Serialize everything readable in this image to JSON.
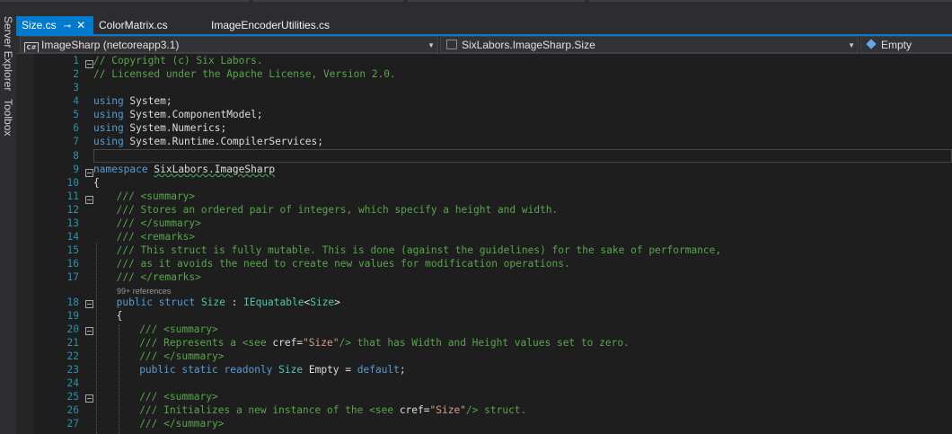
{
  "left_tool_tabs": [
    "Server Explorer",
    "Toolbox"
  ],
  "tabs": [
    {
      "label": "Size.cs",
      "active": true
    },
    {
      "label": "ColorMatrix.cs",
      "active": false
    },
    {
      "label": "ImageEncoderUtilities.cs",
      "active": false
    }
  ],
  "navbar": {
    "project": "ImageSharp (netcoreapp3.1)",
    "type": "SixLabors.ImageSharp.Size",
    "member": "Empty"
  },
  "code_lens": "99+ references",
  "lines": [
    {
      "n": "1",
      "t": "// Copyright (c) Six Labors."
    },
    {
      "n": "2",
      "t": "// Licensed under the Apache License, Version 2.0."
    },
    {
      "n": "3",
      "t": ""
    },
    {
      "n": "4",
      "t": "using System;"
    },
    {
      "n": "5",
      "t": "using System.ComponentModel;"
    },
    {
      "n": "6",
      "t": "using System.Numerics;"
    },
    {
      "n": "7",
      "t": "using System.Runtime.CompilerServices;"
    },
    {
      "n": "8",
      "t": ""
    },
    {
      "n": "9",
      "t": "namespace SixLabors.ImageSharp"
    },
    {
      "n": "10",
      "t": "{"
    },
    {
      "n": "11",
      "t": "/// <summary>"
    },
    {
      "n": "12",
      "t": "/// Stores an ordered pair of integers, which specify a height and width."
    },
    {
      "n": "13",
      "t": "/// </summary>"
    },
    {
      "n": "14",
      "t": "/// <remarks>"
    },
    {
      "n": "15",
      "t": "/// This struct is fully mutable. This is done (against the guidelines) for the sake of performance,"
    },
    {
      "n": "16",
      "t": "/// as it avoids the need to create new values for modification operations."
    },
    {
      "n": "17",
      "t": "/// </remarks>"
    },
    {
      "n": "18",
      "t": "public struct Size : IEquatable<Size>"
    },
    {
      "n": "19",
      "t": "{"
    },
    {
      "n": "20",
      "t": "/// <summary>"
    },
    {
      "n": "21",
      "t": "/// Represents a <see cref=\"Size\"/> that has Width and Height values set to zero."
    },
    {
      "n": "22",
      "t": "/// </summary>"
    },
    {
      "n": "23",
      "t": "public static readonly Size Empty = default;"
    },
    {
      "n": "24",
      "t": ""
    },
    {
      "n": "25",
      "t": "/// <summary>"
    },
    {
      "n": "26",
      "t": "/// Initializes a new instance of the <see cref=\"Size\"/> struct."
    },
    {
      "n": "27",
      "t": "/// </summary>"
    }
  ],
  "colors": {
    "accent": "#007acc",
    "comment": "#57a64a",
    "keyword": "#569cd6",
    "type": "#4ec9b0",
    "line_number": "#2b91af"
  }
}
